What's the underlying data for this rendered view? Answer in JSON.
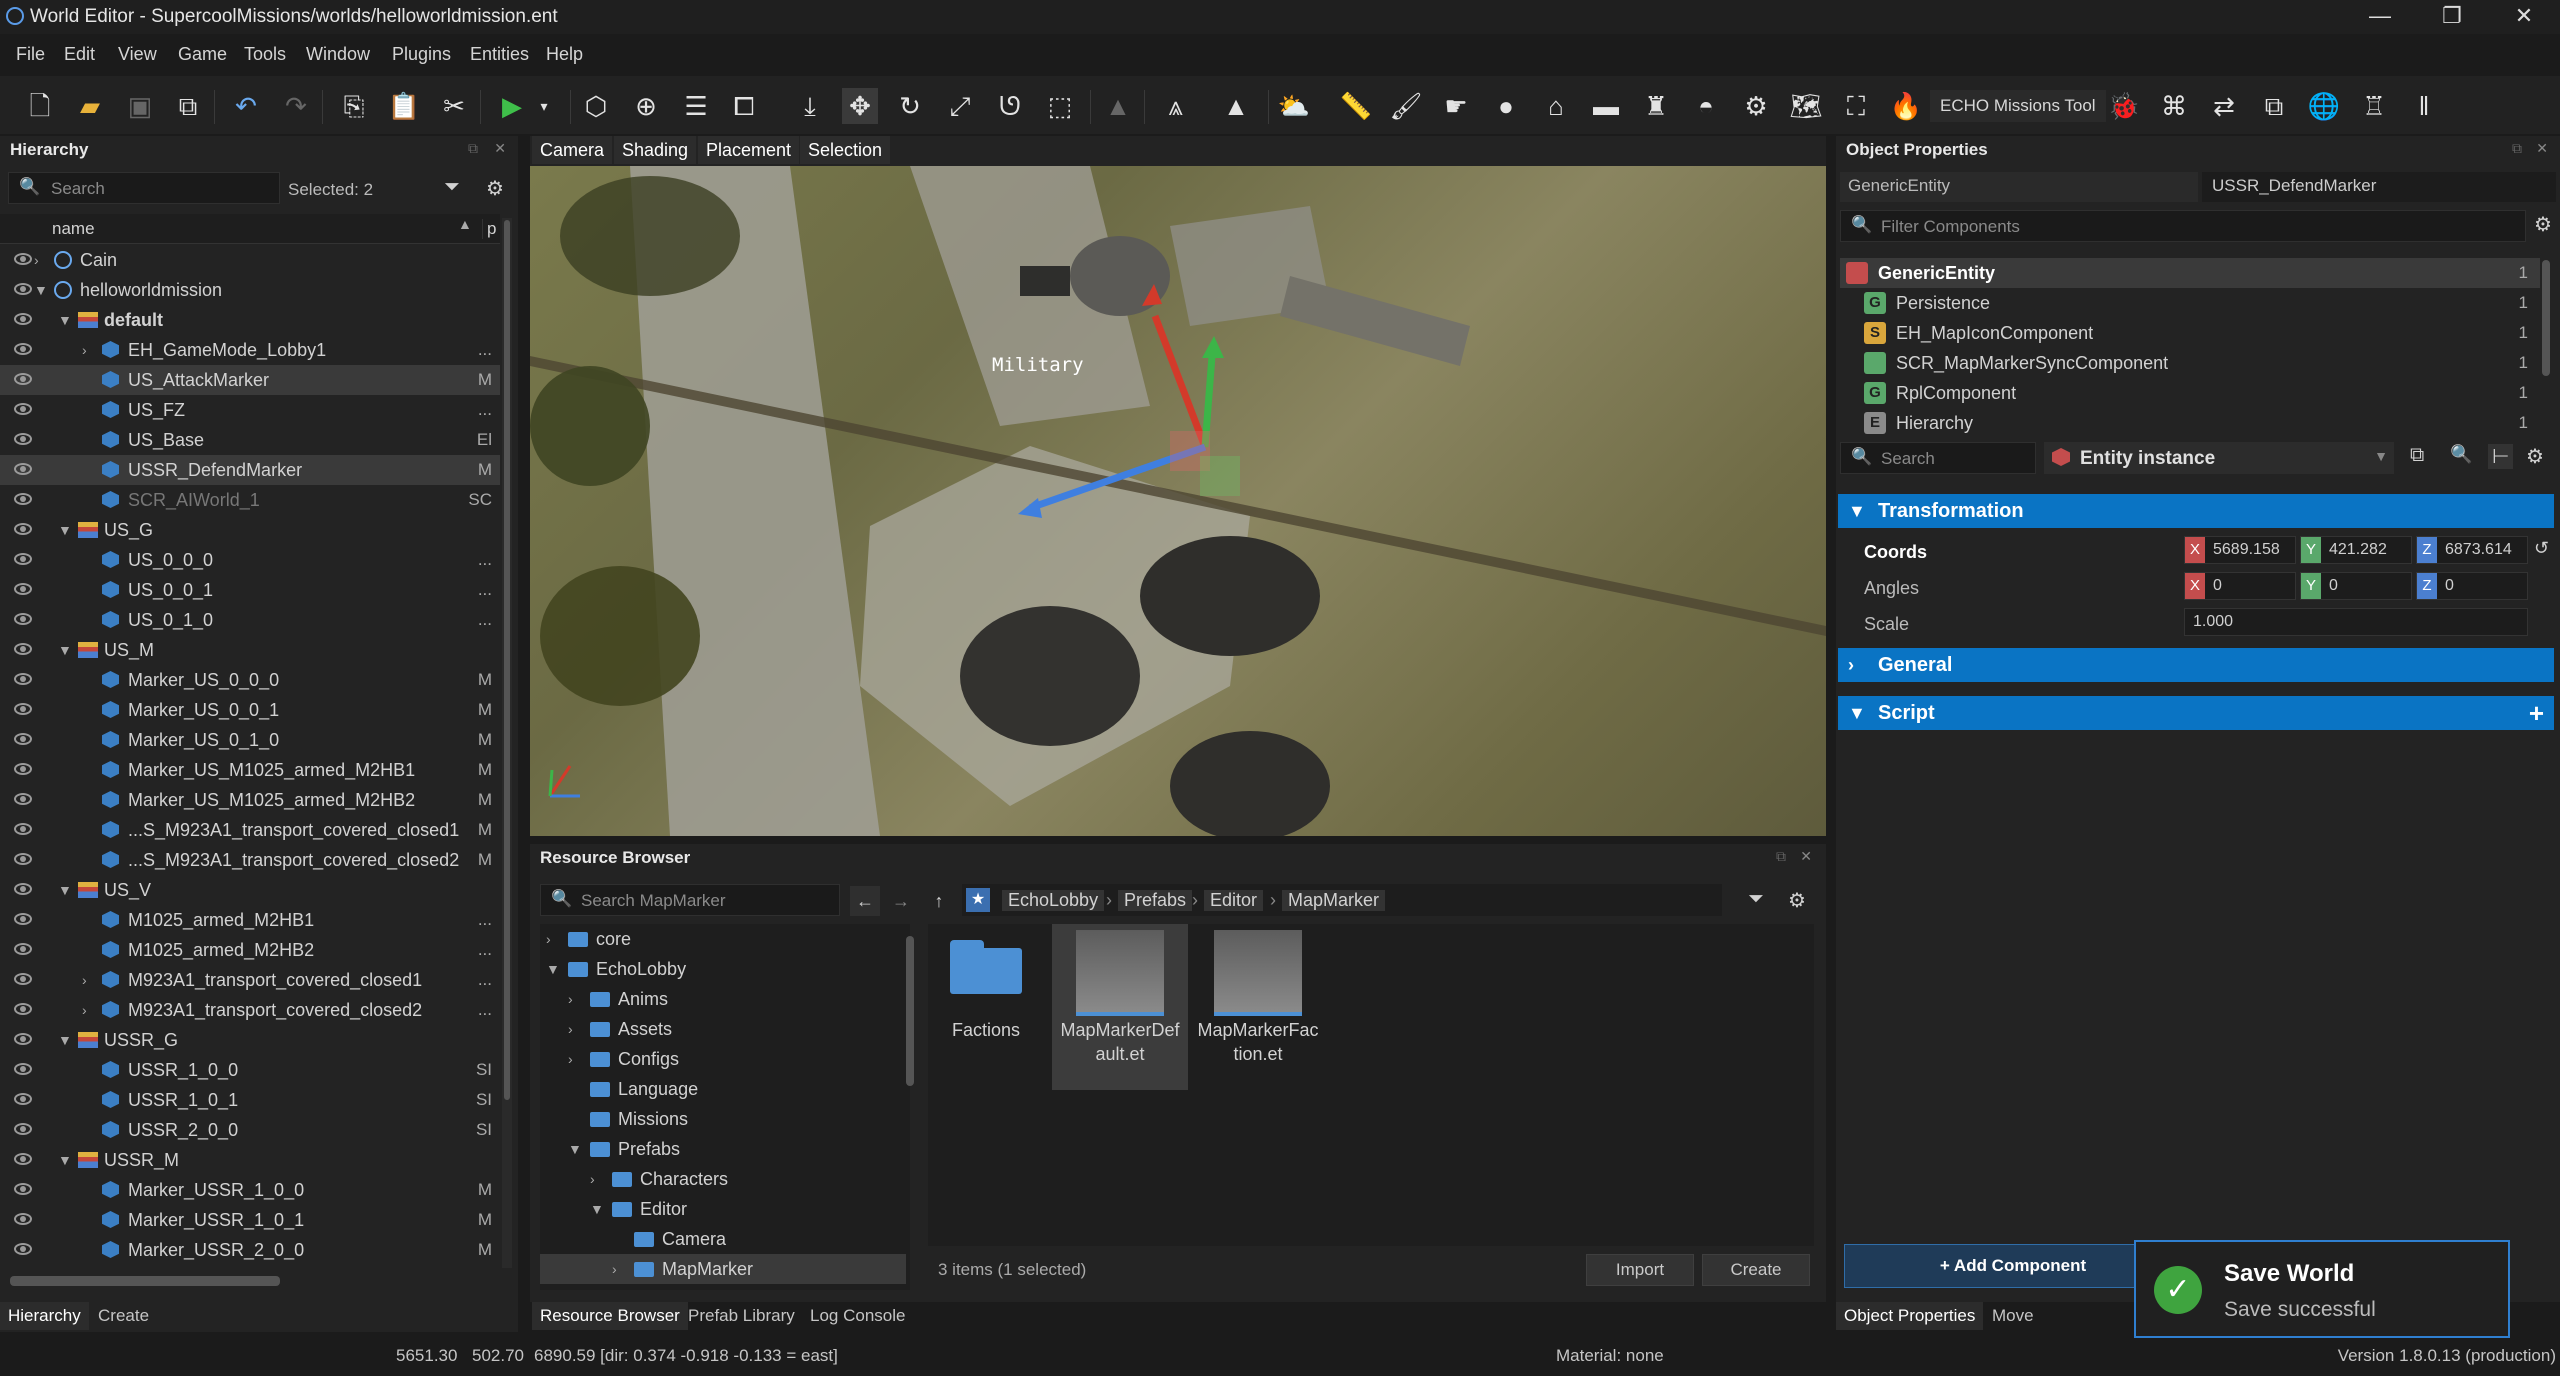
{
  "window": {
    "title": "World Editor - SupercoolMissions/worlds/helloworldmission.ent"
  },
  "menu": [
    "File",
    "Edit",
    "View",
    "Game",
    "Tools",
    "Window",
    "Plugins",
    "Entities",
    "Help"
  ],
  "toolbar": {
    "echo_label": "ECHO Missions Tool"
  },
  "hierarchy": {
    "title": "Hierarchy",
    "search_placeholder": "Search",
    "selected": "Selected: 2",
    "col_name": "name",
    "col_p": "p",
    "rows": [
      {
        "label": "Cain",
        "indent": 1,
        "icon": "globe",
        "arrow": "right",
        "right": ""
      },
      {
        "label": "helloworldmission",
        "indent": 1,
        "icon": "globe",
        "arrow": "down",
        "right": ""
      },
      {
        "label": "default",
        "indent": 2,
        "icon": "layer",
        "arrow": "down",
        "right": "",
        "bold": true
      },
      {
        "label": "EH_GameMode_Lobby1",
        "indent": 3,
        "icon": "cube",
        "arrow": "right",
        "right": "..."
      },
      {
        "label": "US_AttackMarker",
        "indent": 3,
        "icon": "cube",
        "arrow": "",
        "right": "M",
        "sel": true
      },
      {
        "label": "US_FZ",
        "indent": 3,
        "icon": "cube",
        "arrow": "",
        "right": "..."
      },
      {
        "label": "US_Base",
        "indent": 3,
        "icon": "cube",
        "arrow": "",
        "right": "El"
      },
      {
        "label": "USSR_DefendMarker",
        "indent": 3,
        "icon": "cube",
        "arrow": "",
        "right": "M",
        "sel": true
      },
      {
        "label": "SCR_AIWorld_1",
        "indent": 3,
        "icon": "cube",
        "arrow": "",
        "right": "SC",
        "dim": true
      },
      {
        "label": "US_G",
        "indent": 2,
        "icon": "layer",
        "arrow": "down",
        "right": ""
      },
      {
        "label": "US_0_0_0",
        "indent": 3,
        "icon": "cube",
        "arrow": "",
        "right": "..."
      },
      {
        "label": "US_0_0_1",
        "indent": 3,
        "icon": "cube",
        "arrow": "",
        "right": "..."
      },
      {
        "label": "US_0_1_0",
        "indent": 3,
        "icon": "cube",
        "arrow": "",
        "right": "..."
      },
      {
        "label": "US_M",
        "indent": 2,
        "icon": "layer",
        "arrow": "down",
        "right": ""
      },
      {
        "label": "Marker_US_0_0_0",
        "indent": 3,
        "icon": "cube",
        "arrow": "",
        "right": "M"
      },
      {
        "label": "Marker_US_0_0_1",
        "indent": 3,
        "icon": "cube",
        "arrow": "",
        "right": "M"
      },
      {
        "label": "Marker_US_0_1_0",
        "indent": 3,
        "icon": "cube",
        "arrow": "",
        "right": "M"
      },
      {
        "label": "Marker_US_M1025_armed_M2HB1",
        "indent": 3,
        "icon": "cube",
        "arrow": "",
        "right": "M"
      },
      {
        "label": "Marker_US_M1025_armed_M2HB2",
        "indent": 3,
        "icon": "cube",
        "arrow": "",
        "right": "M"
      },
      {
        "label": "...S_M923A1_transport_covered_closed1",
        "indent": 3,
        "icon": "cube",
        "arrow": "",
        "right": "M"
      },
      {
        "label": "...S_M923A1_transport_covered_closed2",
        "indent": 3,
        "icon": "cube",
        "arrow": "",
        "right": "M"
      },
      {
        "label": "US_V",
        "indent": 2,
        "icon": "layer",
        "arrow": "down",
        "right": ""
      },
      {
        "label": "M1025_armed_M2HB1",
        "indent": 3,
        "icon": "cube",
        "arrow": "",
        "right": "..."
      },
      {
        "label": "M1025_armed_M2HB2",
        "indent": 3,
        "icon": "cube",
        "arrow": "",
        "right": "..."
      },
      {
        "label": "M923A1_transport_covered_closed1",
        "indent": 3,
        "icon": "cube",
        "arrow": "right",
        "right": "..."
      },
      {
        "label": "M923A1_transport_covered_closed2",
        "indent": 3,
        "icon": "cube",
        "arrow": "right",
        "right": "..."
      },
      {
        "label": "USSR_G",
        "indent": 2,
        "icon": "layer",
        "arrow": "down",
        "right": ""
      },
      {
        "label": "USSR_1_0_0",
        "indent": 3,
        "icon": "cube",
        "arrow": "",
        "right": "SI"
      },
      {
        "label": "USSR_1_0_1",
        "indent": 3,
        "icon": "cube",
        "arrow": "",
        "right": "SI"
      },
      {
        "label": "USSR_2_0_0",
        "indent": 3,
        "icon": "cube",
        "arrow": "",
        "right": "SI"
      },
      {
        "label": "USSR_M",
        "indent": 2,
        "icon": "layer",
        "arrow": "down",
        "right": ""
      },
      {
        "label": "Marker_USSR_1_0_0",
        "indent": 3,
        "icon": "cube",
        "arrow": "",
        "right": "M"
      },
      {
        "label": "Marker_USSR_1_0_1",
        "indent": 3,
        "icon": "cube",
        "arrow": "",
        "right": "M"
      },
      {
        "label": "Marker_USSR_2_0_0",
        "indent": 3,
        "icon": "cube",
        "arrow": "",
        "right": "M"
      }
    ],
    "tabs": [
      "Hierarchy",
      "Create"
    ]
  },
  "viewport": {
    "tabs": [
      "Camera",
      "Shading",
      "Placement",
      "Selection"
    ],
    "label": "Military"
  },
  "resource": {
    "title": "Resource Browser",
    "search_placeholder": "Search MapMarker",
    "crumbs": [
      "EchoLobby",
      "Prefabs",
      "Editor",
      "MapMarker"
    ],
    "tree": [
      {
        "label": "core",
        "indent": 0,
        "arrow": "right"
      },
      {
        "label": "EchoLobby",
        "indent": 0,
        "arrow": "down"
      },
      {
        "label": "Anims",
        "indent": 1,
        "arrow": "right"
      },
      {
        "label": "Assets",
        "indent": 1,
        "arrow": "right"
      },
      {
        "label": "Configs",
        "indent": 1,
        "arrow": "right"
      },
      {
        "label": "Language",
        "indent": 1,
        "arrow": ""
      },
      {
        "label": "Missions",
        "indent": 1,
        "arrow": ""
      },
      {
        "label": "Prefabs",
        "indent": 1,
        "arrow": "down"
      },
      {
        "label": "Characters",
        "indent": 2,
        "arrow": "right"
      },
      {
        "label": "Editor",
        "indent": 2,
        "arrow": "down"
      },
      {
        "label": "Camera",
        "indent": 3,
        "arrow": ""
      },
      {
        "label": "MapMarker",
        "indent": 3,
        "arrow": "right",
        "sel": true
      }
    ],
    "files": [
      {
        "line1": "Factions",
        "line2": ""
      },
      {
        "line1": "MapMarkerDef",
        "line2": "ault.et"
      },
      {
        "line1": "MapMarkerFac",
        "line2": "tion.et"
      }
    ],
    "count": "3 items (1 selected)",
    "import": "Import",
    "create": "Create",
    "tabs": [
      "Resource Browser",
      "Prefab Library",
      "Log Console"
    ]
  },
  "props": {
    "title": "Object Properties",
    "class": "GenericEntity",
    "name": "USSR_DefendMarker",
    "filter_placeholder": "Filter Components",
    "components": [
      {
        "label": "GenericEntity",
        "letter": "",
        "count": "1",
        "color": "#c44d4d"
      },
      {
        "label": "Persistence",
        "letter": "G",
        "count": "1",
        "color": "#5aa86b"
      },
      {
        "label": "EH_MapIconComponent",
        "letter": "S",
        "count": "1",
        "color": "#d9a63c"
      },
      {
        "label": "SCR_MapMarkerSyncComponent",
        "letter": "",
        "count": "1",
        "color": "#5aa86b"
      },
      {
        "label": "RplComponent",
        "letter": "G",
        "count": "1",
        "color": "#5aa86b"
      },
      {
        "label": "Hierarchy",
        "letter": "E",
        "count": "1",
        "color": "#8a8a8a"
      }
    ],
    "search_placeholder": "Search",
    "instance": "Entity instance",
    "transformation": "Transformation",
    "coords": "Coords",
    "angles": "Angles",
    "scale": "Scale",
    "cx": "5689.158",
    "cy": "421.282",
    "cz": "6873.614",
    "ax": "0",
    "ay": "0",
    "az": "0",
    "sc": "1.000",
    "general": "General",
    "script": "Script",
    "add": "+ Add Component",
    "tabs": [
      "Object Properties",
      "Move"
    ]
  },
  "toast": {
    "title": "Save World",
    "msg": "Save successful"
  },
  "status": {
    "a": "5651.30",
    "b": "502.70",
    "c": "6890.59 [dir: 0.374 -0.918 -0.133 = east]",
    "material": "Material: none",
    "version": "Version 1.8.0.13 (production)"
  }
}
